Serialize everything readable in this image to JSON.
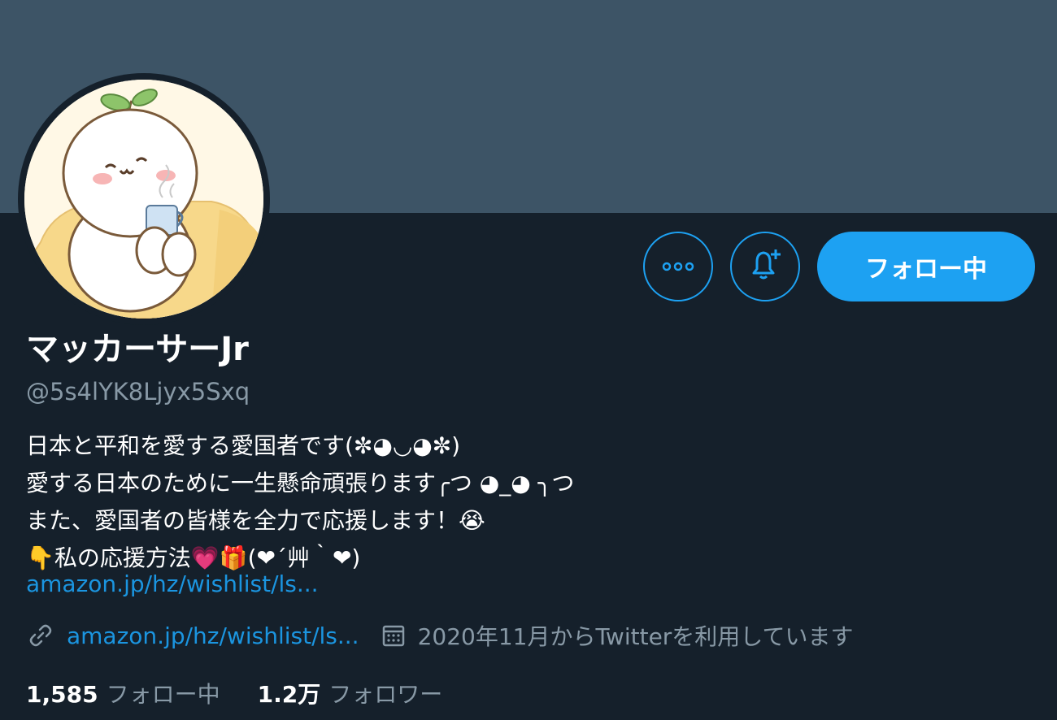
{
  "profile": {
    "display_name": "マッカーサーJr",
    "handle": "@5s4lYK8Ljyx5Sxq",
    "bio_lines": [
      "日本と平和を愛する愛国者です(✼◕◡◕✼)",
      "愛する日本のために一生懸命頑張ります╭つ ◕_◕ ╮つ",
      "また、愛国者の皆様を全力で応援します！😭",
      "👇私の応援方法💗🎁(❤´艸｀❤)"
    ],
    "bio_link": "amazon.jp/hz/wishlist/ls...",
    "website": "amazon.jp/hz/wishlist/ls...",
    "joined": "2020年11月からTwitterを利用しています"
  },
  "actions": {
    "more_icon": "ellipsis-icon",
    "bell_icon": "bell-plus-icon",
    "follow_label": "フォロー中"
  },
  "stats": {
    "following_count": "1,585",
    "following_label": "フォロー中",
    "followers_count": "1.2万",
    "followers_label": "フォロワー"
  },
  "colors": {
    "background": "#15202b",
    "banner": "#3d5466",
    "accent": "#1da1f2",
    "link": "#1b95e0",
    "muted": "#8899a6"
  }
}
